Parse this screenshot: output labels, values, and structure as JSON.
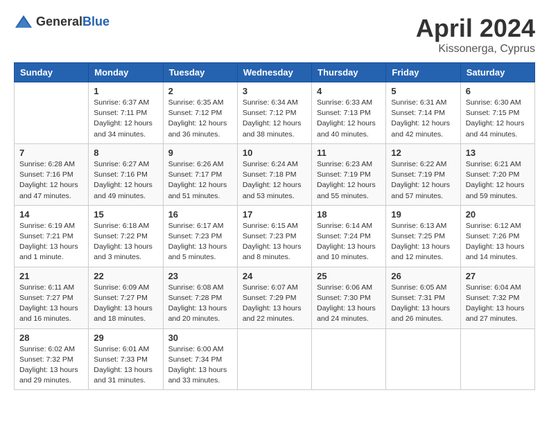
{
  "header": {
    "logo_general": "General",
    "logo_blue": "Blue",
    "month_year": "April 2024",
    "location": "Kissonerga, Cyprus"
  },
  "days_of_week": [
    "Sunday",
    "Monday",
    "Tuesday",
    "Wednesday",
    "Thursday",
    "Friday",
    "Saturday"
  ],
  "weeks": [
    [
      {
        "day": "",
        "info": ""
      },
      {
        "day": "1",
        "info": "Sunrise: 6:37 AM\nSunset: 7:11 PM\nDaylight: 12 hours\nand 34 minutes."
      },
      {
        "day": "2",
        "info": "Sunrise: 6:35 AM\nSunset: 7:12 PM\nDaylight: 12 hours\nand 36 minutes."
      },
      {
        "day": "3",
        "info": "Sunrise: 6:34 AM\nSunset: 7:12 PM\nDaylight: 12 hours\nand 38 minutes."
      },
      {
        "day": "4",
        "info": "Sunrise: 6:33 AM\nSunset: 7:13 PM\nDaylight: 12 hours\nand 40 minutes."
      },
      {
        "day": "5",
        "info": "Sunrise: 6:31 AM\nSunset: 7:14 PM\nDaylight: 12 hours\nand 42 minutes."
      },
      {
        "day": "6",
        "info": "Sunrise: 6:30 AM\nSunset: 7:15 PM\nDaylight: 12 hours\nand 44 minutes."
      }
    ],
    [
      {
        "day": "7",
        "info": "Sunrise: 6:28 AM\nSunset: 7:16 PM\nDaylight: 12 hours\nand 47 minutes."
      },
      {
        "day": "8",
        "info": "Sunrise: 6:27 AM\nSunset: 7:16 PM\nDaylight: 12 hours\nand 49 minutes."
      },
      {
        "day": "9",
        "info": "Sunrise: 6:26 AM\nSunset: 7:17 PM\nDaylight: 12 hours\nand 51 minutes."
      },
      {
        "day": "10",
        "info": "Sunrise: 6:24 AM\nSunset: 7:18 PM\nDaylight: 12 hours\nand 53 minutes."
      },
      {
        "day": "11",
        "info": "Sunrise: 6:23 AM\nSunset: 7:19 PM\nDaylight: 12 hours\nand 55 minutes."
      },
      {
        "day": "12",
        "info": "Sunrise: 6:22 AM\nSunset: 7:19 PM\nDaylight: 12 hours\nand 57 minutes."
      },
      {
        "day": "13",
        "info": "Sunrise: 6:21 AM\nSunset: 7:20 PM\nDaylight: 12 hours\nand 59 minutes."
      }
    ],
    [
      {
        "day": "14",
        "info": "Sunrise: 6:19 AM\nSunset: 7:21 PM\nDaylight: 13 hours\nand 1 minute."
      },
      {
        "day": "15",
        "info": "Sunrise: 6:18 AM\nSunset: 7:22 PM\nDaylight: 13 hours\nand 3 minutes."
      },
      {
        "day": "16",
        "info": "Sunrise: 6:17 AM\nSunset: 7:23 PM\nDaylight: 13 hours\nand 5 minutes."
      },
      {
        "day": "17",
        "info": "Sunrise: 6:15 AM\nSunset: 7:23 PM\nDaylight: 13 hours\nand 8 minutes."
      },
      {
        "day": "18",
        "info": "Sunrise: 6:14 AM\nSunset: 7:24 PM\nDaylight: 13 hours\nand 10 minutes."
      },
      {
        "day": "19",
        "info": "Sunrise: 6:13 AM\nSunset: 7:25 PM\nDaylight: 13 hours\nand 12 minutes."
      },
      {
        "day": "20",
        "info": "Sunrise: 6:12 AM\nSunset: 7:26 PM\nDaylight: 13 hours\nand 14 minutes."
      }
    ],
    [
      {
        "day": "21",
        "info": "Sunrise: 6:11 AM\nSunset: 7:27 PM\nDaylight: 13 hours\nand 16 minutes."
      },
      {
        "day": "22",
        "info": "Sunrise: 6:09 AM\nSunset: 7:27 PM\nDaylight: 13 hours\nand 18 minutes."
      },
      {
        "day": "23",
        "info": "Sunrise: 6:08 AM\nSunset: 7:28 PM\nDaylight: 13 hours\nand 20 minutes."
      },
      {
        "day": "24",
        "info": "Sunrise: 6:07 AM\nSunset: 7:29 PM\nDaylight: 13 hours\nand 22 minutes."
      },
      {
        "day": "25",
        "info": "Sunrise: 6:06 AM\nSunset: 7:30 PM\nDaylight: 13 hours\nand 24 minutes."
      },
      {
        "day": "26",
        "info": "Sunrise: 6:05 AM\nSunset: 7:31 PM\nDaylight: 13 hours\nand 26 minutes."
      },
      {
        "day": "27",
        "info": "Sunrise: 6:04 AM\nSunset: 7:32 PM\nDaylight: 13 hours\nand 27 minutes."
      }
    ],
    [
      {
        "day": "28",
        "info": "Sunrise: 6:02 AM\nSunset: 7:32 PM\nDaylight: 13 hours\nand 29 minutes."
      },
      {
        "day": "29",
        "info": "Sunrise: 6:01 AM\nSunset: 7:33 PM\nDaylight: 13 hours\nand 31 minutes."
      },
      {
        "day": "30",
        "info": "Sunrise: 6:00 AM\nSunset: 7:34 PM\nDaylight: 13 hours\nand 33 minutes."
      },
      {
        "day": "",
        "info": ""
      },
      {
        "day": "",
        "info": ""
      },
      {
        "day": "",
        "info": ""
      },
      {
        "day": "",
        "info": ""
      }
    ]
  ]
}
